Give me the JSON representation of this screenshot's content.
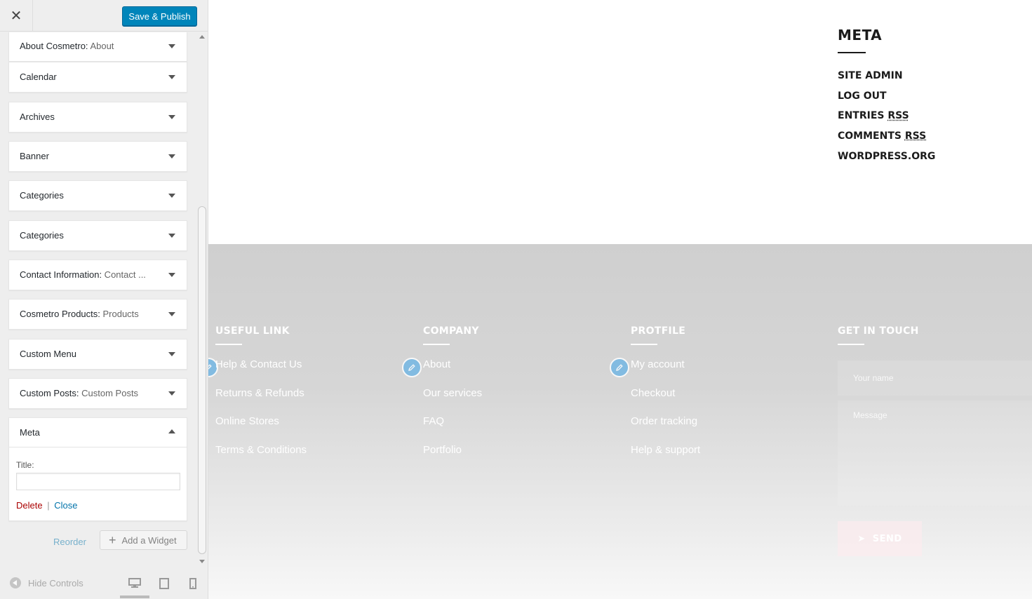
{
  "topbar": {
    "close_glyph": "✕",
    "save_label": "Save & Publish",
    "accent": "#0085ba"
  },
  "widgets": [
    {
      "title": "About Cosmetro:",
      "subtitle": " About"
    },
    {
      "title": "Calendar",
      "subtitle": ""
    },
    {
      "title": "Archives",
      "subtitle": ""
    },
    {
      "title": "Banner",
      "subtitle": ""
    },
    {
      "title": "Categories",
      "subtitle": ""
    },
    {
      "title": "Categories",
      "subtitle": ""
    },
    {
      "title": "Contact Information:",
      "subtitle": " Contact ..."
    },
    {
      "title": "Cosmetro Products:",
      "subtitle": " Products"
    },
    {
      "title": "Custom Menu",
      "subtitle": ""
    },
    {
      "title": "Custom Posts:",
      "subtitle": " Custom Posts"
    }
  ],
  "meta_widget": {
    "title": "Meta",
    "field_label": "Title:",
    "field_value": "",
    "delete_label": "Delete",
    "separator": "|",
    "close_label": "Close"
  },
  "actions": {
    "reorder_label": "Reorder",
    "add_widget_label": "Add a Widget"
  },
  "footer_controls": {
    "hide_label": "Hide Controls",
    "devices": [
      "desktop-icon",
      "tablet-icon",
      "mobile-icon"
    ]
  },
  "preview": {
    "meta": {
      "heading": "META",
      "links": [
        {
          "text": "SITE ADMIN",
          "abbr": ""
        },
        {
          "text": "LOG OUT",
          "abbr": ""
        },
        {
          "text": "ENTRIES ",
          "abbr": "RSS"
        },
        {
          "text": "COMMENTS ",
          "abbr": "RSS"
        },
        {
          "text": "WORDPRESS.ORG",
          "abbr": ""
        }
      ]
    },
    "footer": {
      "columns": [
        {
          "heading": "USEFUL LINK",
          "links": [
            "Help & Contact Us",
            "Returns & Refunds",
            "Online Stores",
            "Terms & Conditions"
          ]
        },
        {
          "heading": "COMPANY",
          "links": [
            "About",
            "Our services",
            "FAQ",
            "Portfolio"
          ]
        },
        {
          "heading": "PROTFILE",
          "links": [
            "My account",
            "Checkout",
            "Order tracking",
            "Help & support"
          ]
        }
      ],
      "contact": {
        "heading": "GET IN TOUCH",
        "name_placeholder": "Your name",
        "message_placeholder": "Message",
        "send_label": "SEND"
      }
    }
  }
}
